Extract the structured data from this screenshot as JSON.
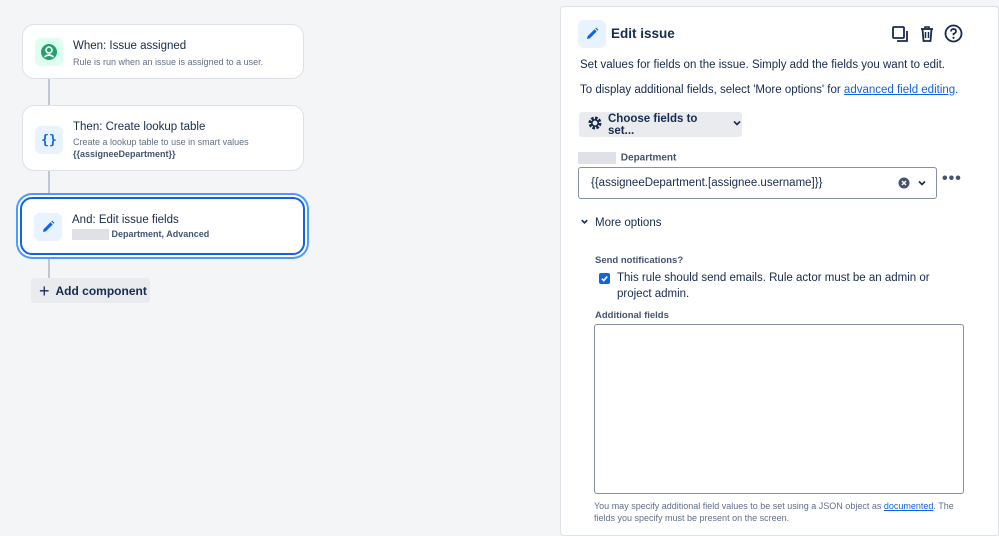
{
  "canvas": {
    "cards": [
      {
        "title": "When: Issue assigned",
        "subtitle": "Rule is run when an issue is assigned to a user.",
        "icon": "trigger-user-icon",
        "accent": "#22a06b"
      },
      {
        "title": "Then: Create lookup table",
        "subtitle": "Create a lookup table to use in smart values",
        "subtitle_bold": "{{assigneeDepartment}}",
        "icon": "braces-icon",
        "accent": "#0c66e4"
      },
      {
        "title": "And: Edit issue fields",
        "subtitle_bold": "Department, Advanced",
        "icon": "pencil-icon",
        "accent": "#0c66e4"
      }
    ],
    "add_component_label": "Add component"
  },
  "panel": {
    "title": "Edit issue",
    "description": "Set values for fields on the issue. Simply add the fields you want to edit.",
    "additional_prefix": "To display additional fields, select 'More options' for ",
    "additional_link": "advanced field editing",
    "additional_suffix": ".",
    "choose_fields_label": "Choose fields to set...",
    "field": {
      "label": "Department",
      "value": "{{assigneeDepartment.[assignee.username]}}"
    },
    "more_options_label": "More options",
    "send_notifications_label": "Send notifications?",
    "send_notifications_text": "This rule should send emails. Rule actor must be an admin or project admin.",
    "send_notifications_checked": true,
    "additional_fields_label": "Additional fields",
    "additional_fields_value": "",
    "help_prefix": "You may specify additional field values to be set using a JSON object as ",
    "help_link": "documented",
    "help_suffix": ". The fields you specify must be present on the screen."
  },
  "colors": {
    "accent": "#0c66e4",
    "success": "#22a06b"
  }
}
